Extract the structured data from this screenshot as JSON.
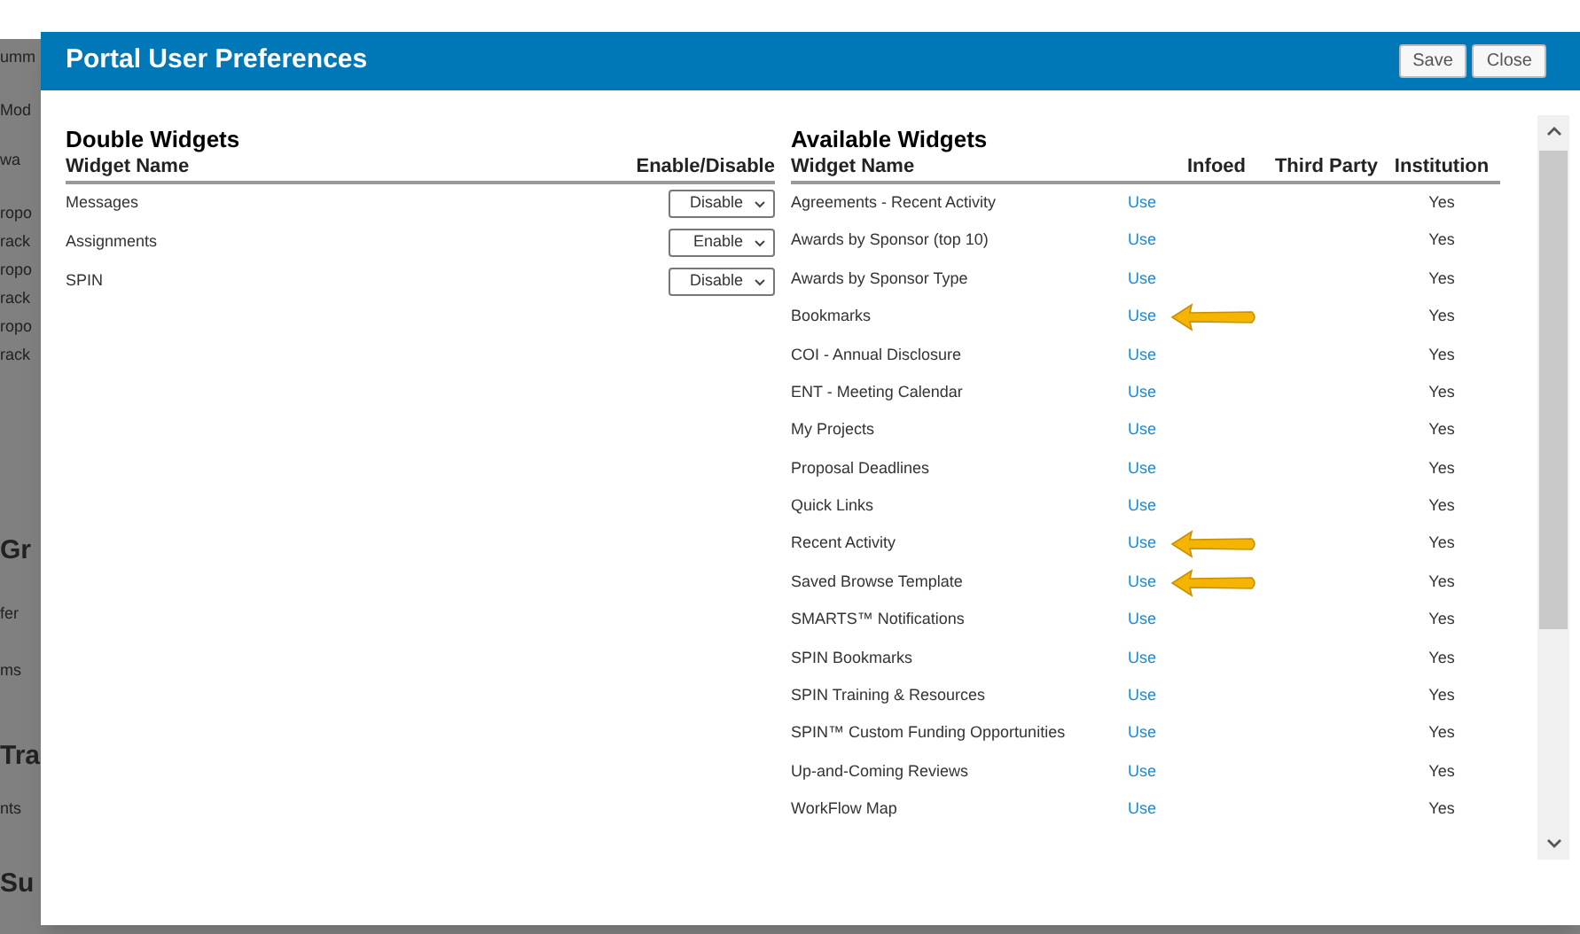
{
  "background_fragments": [
    "umm",
    "Mod",
    "wa",
    "ropo",
    "rack",
    "ropo",
    "rack",
    "ropo",
    "rack",
    "Gr",
    "fer",
    "ms",
    "Tra",
    "nts",
    "Su"
  ],
  "dialog": {
    "title": "Portal User Preferences",
    "buttons": [
      "Save",
      "Close"
    ]
  },
  "double_widgets": {
    "title": "Double Widgets",
    "columns": [
      "Widget Name",
      "Enable/Disable"
    ],
    "rows": [
      {
        "name": "Messages",
        "value": "Disable"
      },
      {
        "name": "Assignments",
        "value": "Enable"
      },
      {
        "name": "SPIN",
        "value": "Disable"
      }
    ]
  },
  "available_widgets": {
    "title": "Available Widgets",
    "columns": [
      "Widget Name",
      "Infoed",
      "Third Party",
      "Institution"
    ],
    "rows": [
      {
        "name": "Agreements - Recent Activity",
        "action": "Use",
        "institution": "Yes",
        "marked": false
      },
      {
        "name": "Awards by Sponsor (top 10)",
        "action": "Use",
        "institution": "Yes",
        "marked": false
      },
      {
        "name": "Awards by Sponsor Type",
        "action": "Use",
        "institution": "Yes",
        "marked": false
      },
      {
        "name": "Bookmarks",
        "action": "Use",
        "institution": "Yes",
        "marked": true
      },
      {
        "name": "COI - Annual Disclosure",
        "action": "Use",
        "institution": "Yes",
        "marked": false
      },
      {
        "name": "ENT - Meeting Calendar",
        "action": "Use",
        "institution": "Yes",
        "marked": false
      },
      {
        "name": "My Projects",
        "action": "Use",
        "institution": "Yes",
        "marked": false
      },
      {
        "name": "Proposal Deadlines",
        "action": "Use",
        "institution": "Yes",
        "marked": false
      },
      {
        "name": "Quick Links",
        "action": "Use",
        "institution": "Yes",
        "marked": false
      },
      {
        "name": "Recent Activity",
        "action": "Use",
        "institution": "Yes",
        "marked": true
      },
      {
        "name": "Saved Browse Template",
        "action": "Use",
        "institution": "Yes",
        "marked": true
      },
      {
        "name": "SMARTS™ Notifications",
        "action": "Use",
        "institution": "Yes",
        "marked": false
      },
      {
        "name": "SPIN Bookmarks",
        "action": "Use",
        "institution": "Yes",
        "marked": false
      },
      {
        "name": "SPIN Training & Resources",
        "action": "Use",
        "institution": "Yes",
        "marked": false
      },
      {
        "name": "SPIN™ Custom Funding Opportunities",
        "action": "Use",
        "institution": "Yes",
        "marked": false
      },
      {
        "name": "Up-and-Coming Reviews",
        "action": "Use",
        "institution": "Yes",
        "marked": false
      },
      {
        "name": "WorkFlow Map",
        "action": "Use",
        "institution": "Yes",
        "marked": false
      }
    ]
  }
}
